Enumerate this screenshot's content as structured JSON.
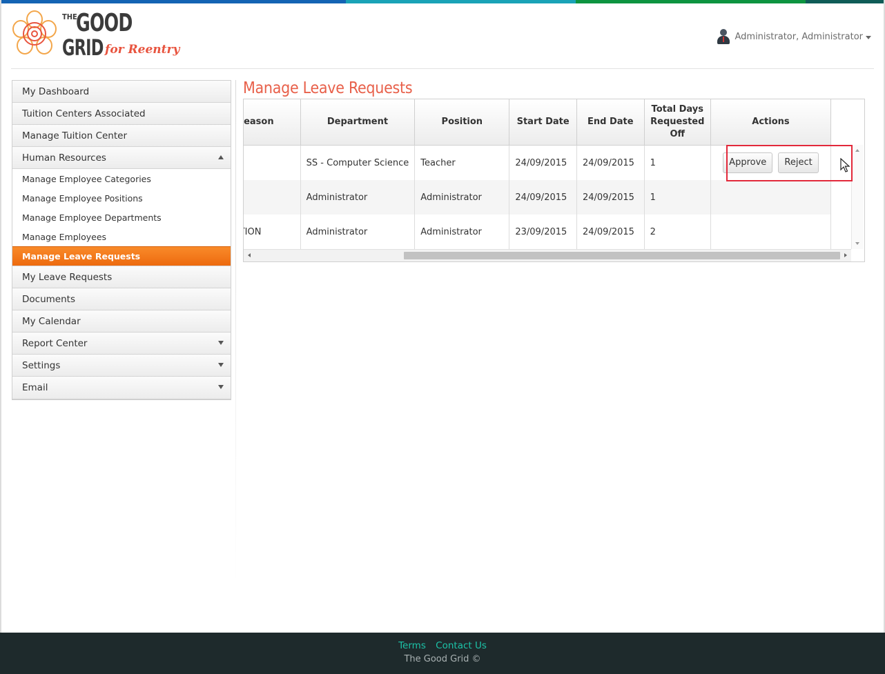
{
  "brand": {
    "logo_the": "THE",
    "logo_good": "GOOD",
    "logo_grid": "GRID",
    "logo_tagline": "for Reentry",
    "topbar_colors": [
      "#1464b4",
      "#1aa3b7",
      "#0d9440",
      "#0f5c57"
    ],
    "accent": "#e8604a",
    "active_nav": "#f07a1d"
  },
  "user": {
    "name": "Administrator, Administrator",
    "avatar_icon": "user-avatar-icon"
  },
  "sidebar": {
    "items": [
      {
        "label": "My Dashboard"
      },
      {
        "label": "Tuition Centers Associated"
      },
      {
        "label": "Manage Tuition Center"
      },
      {
        "label": "Human Resources"
      },
      {
        "label": "My Leave Requests"
      },
      {
        "label": "Documents"
      },
      {
        "label": "My Calendar"
      },
      {
        "label": "Report Center"
      },
      {
        "label": "Settings"
      },
      {
        "label": "Email"
      }
    ],
    "human_resources_sub": [
      {
        "label": "Manage Employee Categories"
      },
      {
        "label": "Manage Employee Positions"
      },
      {
        "label": "Manage Employee Departments"
      },
      {
        "label": "Manage Employees"
      },
      {
        "label": "Manage Leave Requests"
      }
    ]
  },
  "main": {
    "title": "Manage Leave Requests",
    "table": {
      "headers": [
        "Reason",
        "Department",
        "Position",
        "Start Date",
        "End Date",
        "Total Days Requested Off",
        "Actions"
      ],
      "rows": [
        {
          "reason": "",
          "department": "SS - Computer Science",
          "position": "Teacher",
          "start": "24/09/2015",
          "end": "24/09/2015",
          "days": "1"
        },
        {
          "reason": "",
          "department": "Administrator",
          "position": "Administrator",
          "start": "24/09/2015",
          "end": "24/09/2015",
          "days": "1"
        },
        {
          "reason": "VACATION",
          "department": "Administrator",
          "position": "Administrator",
          "start": "23/09/2015",
          "end": "24/09/2015",
          "days": "2"
        }
      ],
      "approve_label": "Approve",
      "reject_label": "Reject"
    }
  },
  "footer": {
    "terms": "Terms",
    "contact": "Contact Us",
    "copyright": "The Good Grid ©"
  }
}
